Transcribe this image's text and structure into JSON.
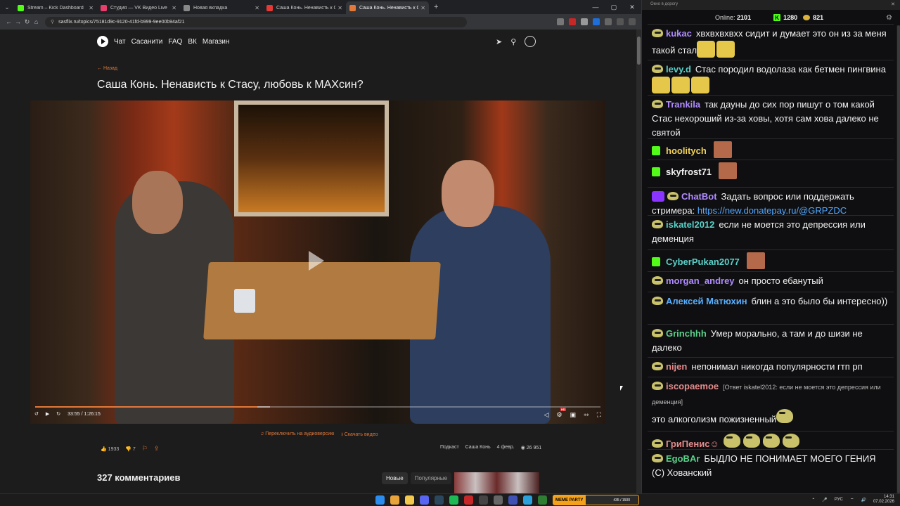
{
  "browser": {
    "tabs": [
      {
        "label": "Stream – Kick Dashboard",
        "color": "#53fc18"
      },
      {
        "label": "Студия — VK Видео Live",
        "color": "#e83e6c"
      },
      {
        "label": "Новая вкладка",
        "color": "#888888"
      },
      {
        "label": "Саша Конь. Ненависть к Стасу",
        "color": "#e53935"
      },
      {
        "label": "Саша Конь. Ненависть к Стасу",
        "color": "#e2793a"
      }
    ],
    "active_tab": 4,
    "new_tab": "+",
    "url": "sasflix.ru/topics/75181d9c-9120-41fd-b999-9ee00b94af21"
  },
  "site": {
    "nav": [
      "Чат",
      "Сасанити",
      "FAQ",
      "ВК",
      "Магазин"
    ],
    "back_label": "← Назад",
    "title": "Саша Конь. Ненависть к Стасу, любовь к МАХсин?",
    "player": {
      "time": "33:55 / 1:26:15",
      "progress": 0.393,
      "buffered": 0.415
    },
    "audio_link": "Переключить на аудиоверсию",
    "download_link": "Скачать видео",
    "likes": "1933",
    "dislikes": "7",
    "tags": [
      "Подкаст",
      "Саша Конь"
    ],
    "date": "4 февр.",
    "views": "26 951",
    "comments_title": "327 комментариев",
    "sort_new": "Новые",
    "sort_popular": "Популярные"
  },
  "chat": {
    "window_title": "Окно в дорогу",
    "online_label": "Online:",
    "online": "2101",
    "kick_count": "1280",
    "coins": "821",
    "messages": [
      {
        "user": "kukac",
        "color": "#b08cff",
        "text": "хвхвхвхвхх сидит и думает это он из за меня такой стал",
        "badge": "pepe"
      },
      {
        "user": "levy.d",
        "color": "#5ad1c8",
        "text": "Стас породил водолаза как бетмен пингвина",
        "badge": "pepe"
      },
      {
        "user": "Trankila",
        "color": "#b08cff",
        "text": "так дауны до сих пор пишут о том какой Стас нехороший из-за ховы, хотя сам хова далеко не святой",
        "badge": "pepe"
      },
      {
        "user": "hoolitych",
        "color": "#f2d35a",
        "text": "",
        "badge": "kick"
      },
      {
        "user": "skyfrost71",
        "color": "#f0f0f0",
        "text": "",
        "badge": "kick"
      },
      {
        "user": "ChatBot",
        "color": "#b08cff",
        "text": "Задать вопрос или поддержать стримера:",
        "link": "https://new.donatepay.ru/@GRPZDC",
        "badge": "bot"
      },
      {
        "user": "iskatel2012",
        "color": "#5ad1c8",
        "text": "если не моется это депрессия или деменция",
        "badge": "pepe"
      },
      {
        "user": "CyberPukan2077",
        "color": "#5ad1c8",
        "text": "",
        "badge": "kick"
      },
      {
        "user": "morgan_andrey",
        "color": "#b08cff",
        "text": "он просто ебанутый",
        "badge": "pepe"
      },
      {
        "user": "Алексей Матюхин",
        "color": "#5ab0ff",
        "text": "блин а это было бы интересно))",
        "badge": "pepe"
      },
      {
        "user": "Grinchhh",
        "color": "#5ad18a",
        "text": "Умер морально, а там и до шизи не далеко",
        "badge": "pepe"
      },
      {
        "user": "nijen",
        "color": "#e88b8b",
        "text": "непонимал никогда популярности гтп рп",
        "badge": "pepe"
      },
      {
        "user": "iscopaemoe",
        "color": "#e88b8b",
        "reply": "[Ответ iskatel2012: если не моется это депрессия или деменция]",
        "text": "это алкоголизм пожизненный",
        "badge": "pepe"
      },
      {
        "user": "ГриПенис☺",
        "color": "#e88b8b",
        "text": "",
        "badge": "pepe"
      },
      {
        "user": "EgoBAr",
        "color": "#5ad18a",
        "text": "БЫДЛО НЕ ПОНИМАЕТ МОЕГО ГЕНИЯ (С) Хованский",
        "badge": "pepe"
      }
    ]
  },
  "taskbar": {
    "meme_label": "MEME PARTY",
    "meme_count": "435 / 1500",
    "lang": "РУС",
    "time": "14:31",
    "date": "07.02.2026"
  }
}
